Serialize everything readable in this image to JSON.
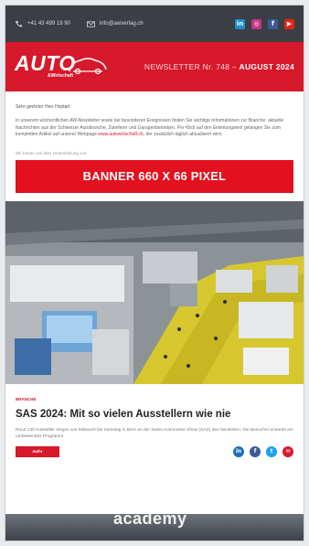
{
  "topbar": {
    "phone": "+41 43 499 19 90",
    "email": "info@awverlag.ch",
    "social_icons": [
      "linkedin-icon",
      "instagram-icon",
      "facebook-icon",
      "youtube-icon"
    ]
  },
  "header": {
    "logo_main": "AUTO",
    "logo_sub": "&Wirtschaft",
    "newsletter_prefix": "NEWSLETTER Nr. 748 – ",
    "newsletter_month": "AUGUST 2024",
    "brand_color": "#d6192b"
  },
  "intro": {
    "greeting": "Sehr geehrter Herr Hoptart",
    "paragraph": "In unserem wöchentlichen AW-Newsletter sowie bei besonderen Ereignissen finden Sie wichtige Informationen zur Branche: aktuelle Nachrichten aus der Schweizer Autobranche, Zulieferer und Garagenbetrieben. Per Klick auf den Einleitungstext gelangen Sie zum kompletten Artikel auf unserer Webpage",
    "link": "www.autowirtschaft.ch",
    "paragraph_end": ", der zusätzlich täglich aktualisiert wird."
  },
  "sponsor_label": "Wir freuen uns über Unterstützung von:",
  "banner": {
    "label": "BANNER 660 X 66 PIXEL"
  },
  "article": {
    "category": "BRANCHE",
    "title": "SAS 2024: Mit so vielen Ausstellern wie nie",
    "text": "Rund 140 Aussteller zeigen von Mittwoch bis Samstag in Bern an der Swiss Automotive Show (SAS) ihre Neuheiten. Die Besucher erwartet ein umfassendes Programm.",
    "more_label": "mehr",
    "share_icons": [
      "linkedin-icon",
      "facebook-icon",
      "twitter-icon",
      "mail-icon"
    ]
  },
  "next_image": {
    "sign_text": "academy"
  }
}
